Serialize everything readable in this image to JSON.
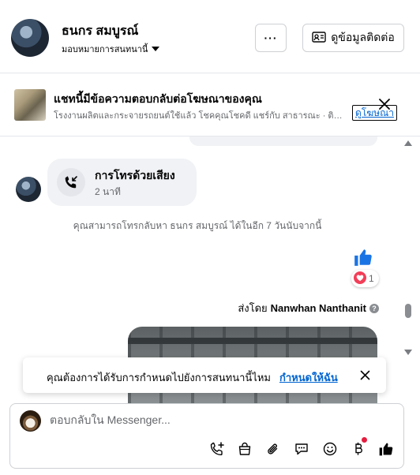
{
  "header": {
    "name": "ธนกร สมบูรณ์",
    "assign_label": "มอบหมายการสนทนานี้",
    "more_label": "···",
    "contact_label": "ดูข้อมูลติดต่อ"
  },
  "ad_banner": {
    "title": "แชทนี้มีข้อความตอบกลับต่อโฆษณาของคุณ",
    "subtitle": "โรงงานผลิตและกระจายรถยนต์ใช้แล้ว โชคคุณโชคดี แชร์กับ สาธารณะ · ติดต่อ",
    "link_label": "ดูโฆษณา"
  },
  "thread": {
    "call": {
      "title": "การโทรด้วยเสียง",
      "duration": "2 นาที"
    },
    "system_message": "คุณสามารถโทรกลับหา ธนกร สมบูรณ์ ได้ในอีก 7 วันนับจากนี้",
    "reaction_count": "1",
    "sent_by_prefix": "ส่งโดย",
    "sent_by_name": "Nanwhan Nanthanit",
    "info_glyph": "?"
  },
  "toast": {
    "text": "คุณต้องการได้รับการกำหนดไปยังการสนทนานี้ไหม",
    "link_label": "กำหนดให้ฉัน"
  },
  "composer": {
    "placeholder": "ตอบกลับใน Messenger..."
  },
  "colors": {
    "accent_blue": "#0064d1",
    "like_blue": "#1b74e4",
    "heart_red": "#f33e58",
    "bubble_gray": "#f0f2f5"
  },
  "icons": {
    "call": "phone-incoming-icon",
    "add_call": "phone-plus-icon",
    "shop": "shopping-bag-icon",
    "attach": "paperclip-icon",
    "saved_reply": "chat-bubble-icon",
    "emoji": "smiley-icon",
    "payment": "baht-icon",
    "like": "thumbs-up-icon"
  }
}
